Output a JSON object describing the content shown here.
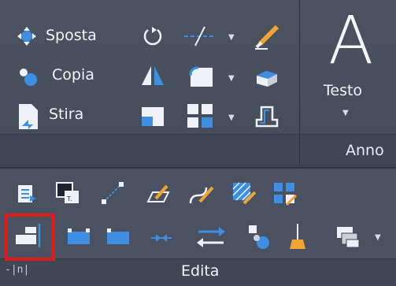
{
  "modify_panel": {
    "sposta_label": "Sposta",
    "copia_label": "Copia",
    "stira_label": "Stira"
  },
  "annotation_panel": {
    "text_button_glyph": "A",
    "text_label": "Testo",
    "title": "Anno"
  },
  "edit_panel": {
    "title": "Edita",
    "left_glyph": "-|n|"
  },
  "icons": {
    "accent_blue": "#3c8fe3",
    "accent_orange": "#f1a334",
    "highlight_red": "#e11a1a"
  }
}
